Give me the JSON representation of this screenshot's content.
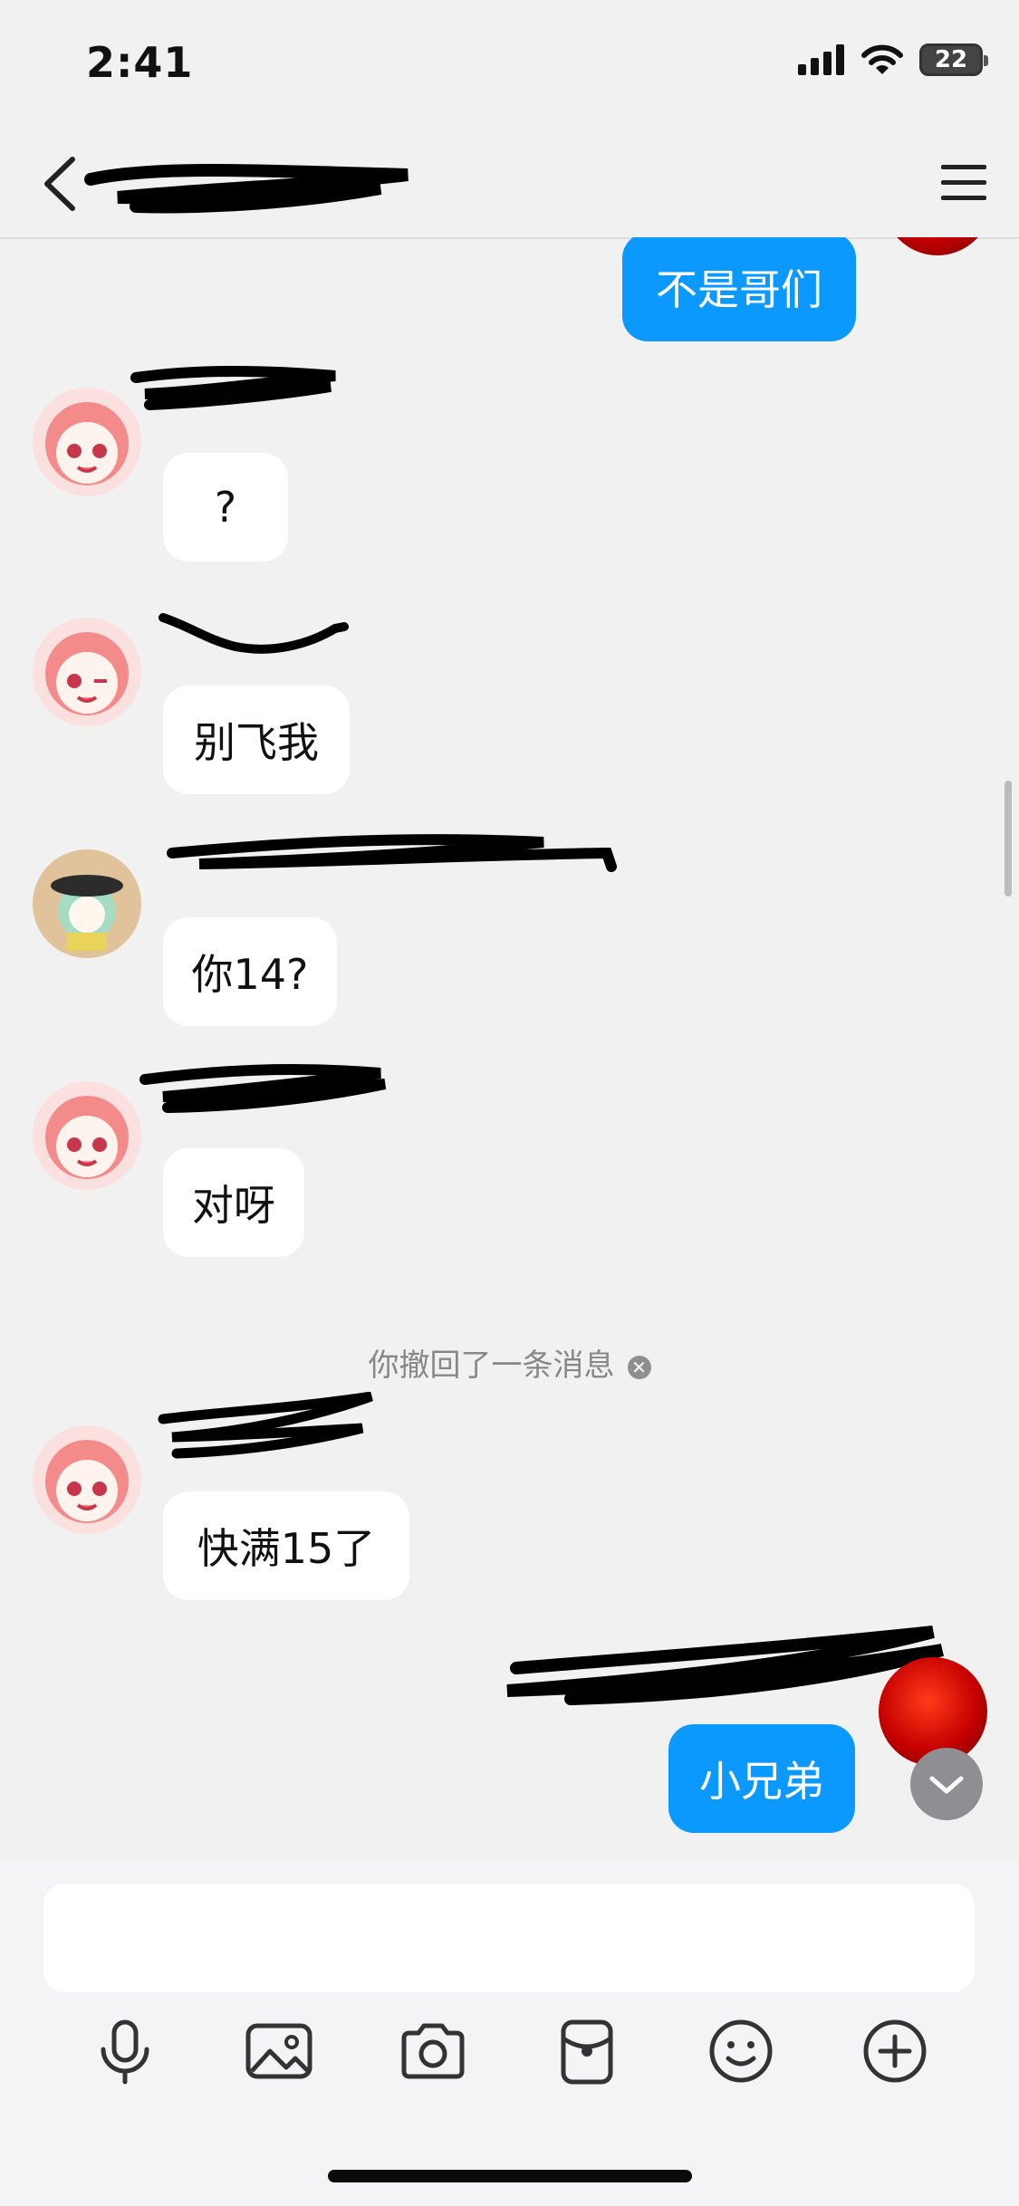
{
  "status_bar": {
    "time": "2:41",
    "battery": "22"
  },
  "nav": {
    "title": ""
  },
  "messages": [
    {
      "id": "m1",
      "direction": "out",
      "text": "不是哥们"
    },
    {
      "id": "m2",
      "direction": "in",
      "text": "?"
    },
    {
      "id": "m3",
      "direction": "in",
      "text": "别飞我"
    },
    {
      "id": "m4",
      "direction": "in",
      "text": "你14?"
    },
    {
      "id": "m5",
      "direction": "in",
      "text": "对呀"
    },
    {
      "id": "m6",
      "direction": "in",
      "text": "快满15了"
    },
    {
      "id": "m7",
      "direction": "out",
      "text": "小兄弟"
    }
  ],
  "recall_notice": {
    "text": "你撤回了一条消息"
  },
  "input": {
    "value": "",
    "placeholder": ""
  },
  "toolbar": {
    "icons": [
      "microphone-icon",
      "image-icon",
      "camera-icon",
      "red-packet-icon",
      "emoji-icon",
      "plus-icon"
    ]
  },
  "colors": {
    "outgoing_bubble": "#0b99ff",
    "incoming_bubble": "#ffffff",
    "background": "#f1f1f2"
  }
}
